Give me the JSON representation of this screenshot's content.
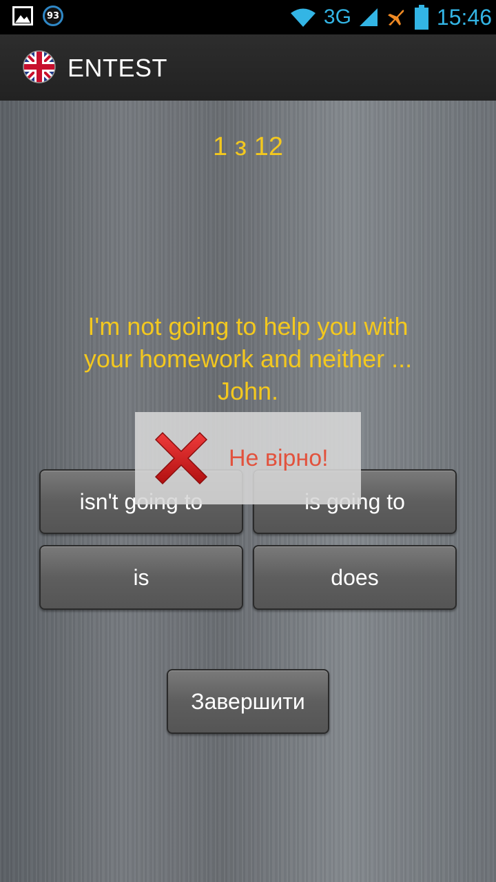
{
  "status_bar": {
    "notification_badge": "93",
    "network": "3G",
    "time": "15:46",
    "icons": [
      "gallery-icon",
      "badge-icon",
      "wifi-icon",
      "signal-icon",
      "airplane-icon",
      "battery-icon"
    ],
    "accent": "#33b5e5"
  },
  "action_bar": {
    "title": "ENTEST",
    "icon": "uk-flag-icon"
  },
  "quiz": {
    "counter": "1 з 12",
    "question": "I'm not going to help you with your homework and neither ... John.",
    "answers": [
      "isn't going to",
      "is going to",
      "is",
      "does"
    ],
    "finish_label": "Завершити",
    "text_color": "#f3c81f"
  },
  "toast": {
    "message": "Не вірно!",
    "icon": "wrong-x-icon",
    "color": "#e2523d"
  }
}
